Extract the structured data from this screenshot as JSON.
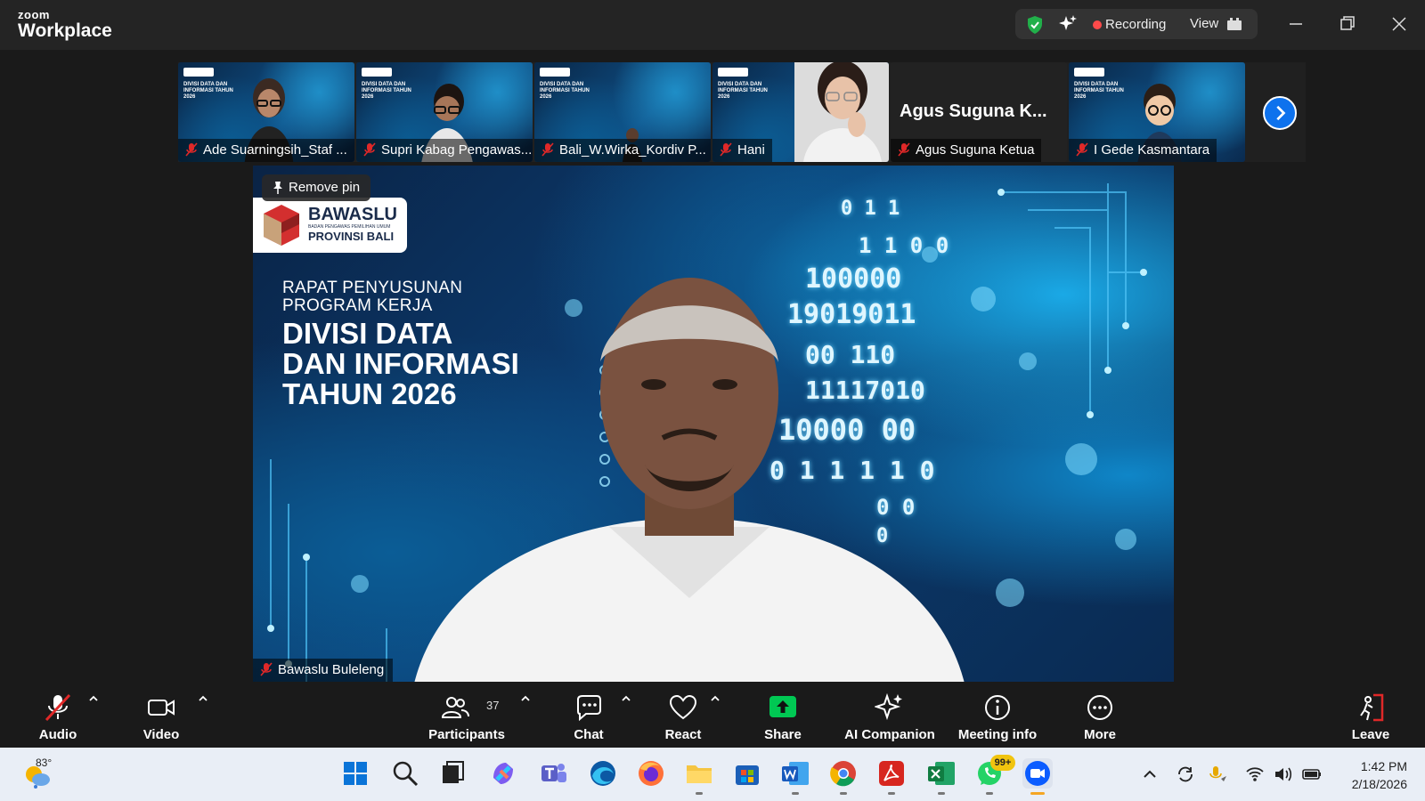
{
  "titlebar": {
    "brand_small": "zoom",
    "brand_large": "Workplace",
    "recording_label": "Recording",
    "view_label": "View"
  },
  "thumbnails": [
    {
      "name": "Ade Suarningsih_Staf ..."
    },
    {
      "name": "Supri Kabag Pengawas..."
    },
    {
      "name": "Bali_W.Wirka_Kordiv P..."
    },
    {
      "name": "Hani"
    },
    {
      "name": "Agus Suguna Ketua",
      "display_name": "Agus Suguna K..."
    },
    {
      "name": "I Gede Kasmantara"
    }
  ],
  "mini_slide_text": "DIVISI DATA DAN INFORMASI TAHUN 2026",
  "main_video": {
    "pin_label": "Remove pin",
    "logo_title": "BAWASLU",
    "logo_subtitle": "BADAN PENGAWAS PEMILIHAN UMUM",
    "logo_region": "PROVINSI BALI",
    "slide_subtitle_line1": "RAPAT PENYUSUNAN",
    "slide_subtitle_line2": "PROGRAM KERJA",
    "slide_title_line1": "DIVISI DATA",
    "slide_title_line2": "DAN INFORMASI",
    "slide_title_line3": "TAHUN 2026",
    "binary_lines": [
      "0 1 1",
      "1 1 0 0",
      "100000",
      "19019011",
      "00 110",
      "11117010",
      "10000 00",
      "0 1 1 1 1 0",
      "0 0",
      "0"
    ],
    "participant_label": "Bawaslu Buleleng"
  },
  "controls": {
    "audio": "Audio",
    "video": "Video",
    "participants": "Participants",
    "participants_count": "37",
    "chat": "Chat",
    "react": "React",
    "share": "Share",
    "ai_companion": "AI Companion",
    "meeting_info": "Meeting info",
    "more": "More",
    "leave": "Leave"
  },
  "taskbar": {
    "temperature": "83°",
    "whatsapp_badge": "99+",
    "time": "1:42 PM",
    "date": "2/18/2026"
  },
  "colors": {
    "titlebar": "#242424",
    "controls": "#1a1a1a",
    "accent_blue": "#0e72ed",
    "share_green": "#00c853",
    "recording_red": "#ff4a4a",
    "muted_red": "#e02828"
  }
}
